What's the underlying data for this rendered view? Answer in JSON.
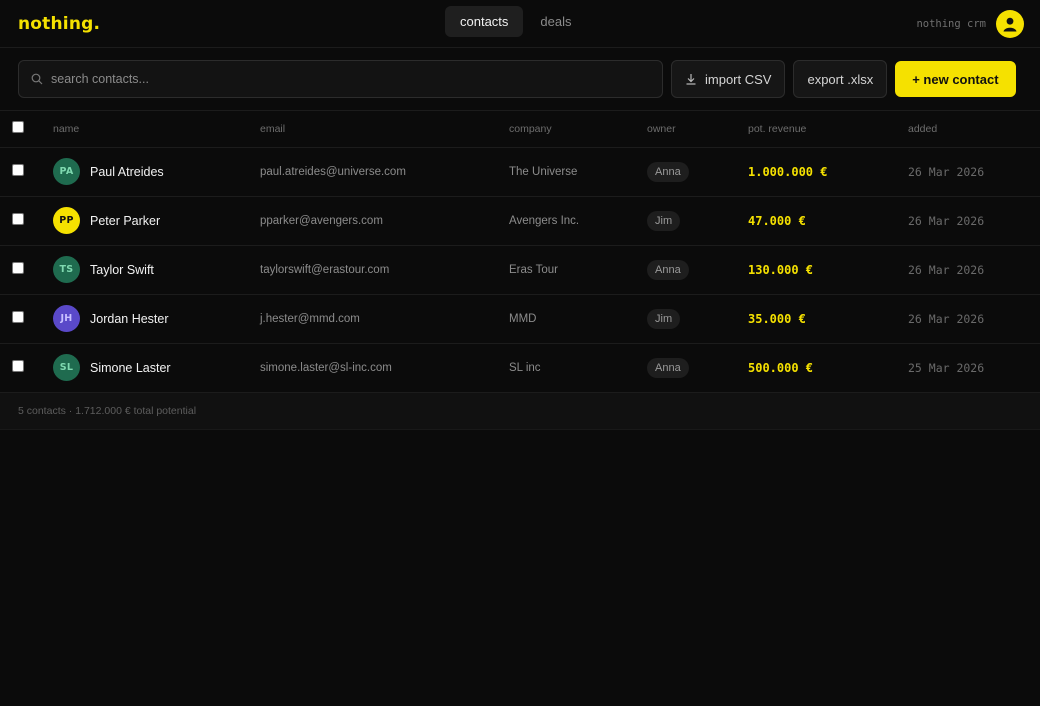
{
  "app": {
    "logo": "nothing.",
    "brand_text": "nothing crm",
    "accent": "#f5e100"
  },
  "nav": {
    "tabs": [
      {
        "label": "contacts",
        "active": true
      },
      {
        "label": "deals",
        "active": false
      }
    ]
  },
  "toolbar": {
    "search_placeholder": "search contacts...",
    "import_label": "import CSV",
    "export_label": "export .xlsx",
    "new_label": "+ new contact"
  },
  "table": {
    "headers": {
      "name": "name",
      "email": "email",
      "company": "company",
      "owner": "owner",
      "revenue": "pot. revenue",
      "added": "added"
    },
    "rows": [
      {
        "initials": "PA",
        "avatar_color": "#1f6b4f",
        "initials_color": "#7fd9b0",
        "name": "Paul Atreides",
        "email": "paul.atreides@universe.com",
        "company": "The Universe",
        "owner": "Anna",
        "revenue": "1.000.000 €",
        "added": "26 Mar 2026"
      },
      {
        "initials": "PP",
        "avatar_color": "#f5e100",
        "initials_color": "#111111",
        "name": "Peter Parker",
        "email": "pparker@avengers.com",
        "company": "Avengers Inc.",
        "owner": "Jim",
        "revenue": "47.000 €",
        "added": "26 Mar 2026"
      },
      {
        "initials": "TS",
        "avatar_color": "#1f6b4f",
        "initials_color": "#7fd9b0",
        "name": "Taylor Swift",
        "email": "taylorswift@erastour.com",
        "company": "Eras Tour",
        "owner": "Anna",
        "revenue": "130.000 €",
        "added": "26 Mar 2026"
      },
      {
        "initials": "JH",
        "avatar_color": "#5a49c9",
        "initials_color": "#c8c0ff",
        "name": "Jordan Hester",
        "email": "j.hester@mmd.com",
        "company": "MMD",
        "owner": "Jim",
        "revenue": "35.000 €",
        "added": "26 Mar 2026"
      },
      {
        "initials": "SL",
        "avatar_color": "#1f6b4f",
        "initials_color": "#7fd9b0",
        "name": "Simone Laster",
        "email": "simone.laster@sl-inc.com",
        "company": "SL inc",
        "owner": "Anna",
        "revenue": "500.000 €",
        "added": "25 Mar 2026"
      }
    ]
  },
  "footer": {
    "summary": "5 contacts · 1.712.000 € total potential"
  }
}
